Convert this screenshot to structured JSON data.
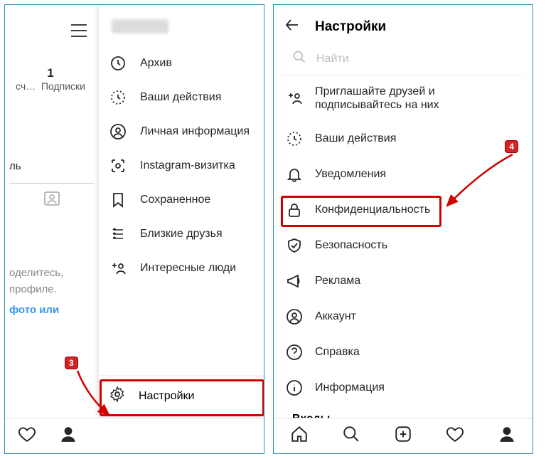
{
  "left": {
    "profile": {
      "count": "1",
      "count_prefix": "сч…",
      "subs_label": "Подписки"
    },
    "tab_label": "ль",
    "share_line1": "оделитесь,",
    "share_line2": "профиле.",
    "share_link": "фото или",
    "menu": [
      {
        "label": "Архив"
      },
      {
        "label": "Ваши действия"
      },
      {
        "label": "Личная информация"
      },
      {
        "label": "Instagram-визитка"
      },
      {
        "label": "Сохраненное"
      },
      {
        "label": "Близкие друзья"
      },
      {
        "label": "Интересные люди"
      }
    ],
    "settings_label": "Настройки"
  },
  "right": {
    "title": "Настройки",
    "search_placeholder": "Найти",
    "invite_line1": "Приглашайте друзей и",
    "invite_line2": "подписывайтесь на них",
    "items": [
      {
        "label": "Ваши действия"
      },
      {
        "label": "Уведомления"
      },
      {
        "label": "Конфиденциальность"
      },
      {
        "label": "Безопасность"
      },
      {
        "label": "Реклама"
      },
      {
        "label": "Аккаунт"
      },
      {
        "label": "Справка"
      },
      {
        "label": "Информация"
      }
    ],
    "section_logins": "Входы"
  },
  "annotations": {
    "step3": "3",
    "step4": "4"
  }
}
